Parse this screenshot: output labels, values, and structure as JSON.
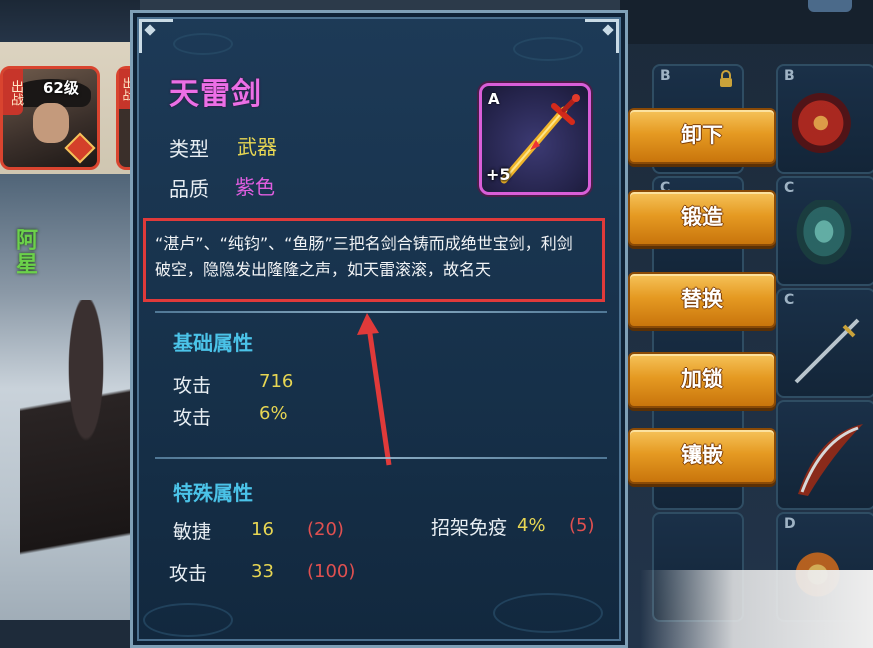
{
  "hero": {
    "status_tag": "出战",
    "level": "62级",
    "status_tag_2": "出战",
    "name": "阿星"
  },
  "item": {
    "name": "天雷剑",
    "type_label": "类型",
    "type_value": "武器",
    "quality_label": "品质",
    "quality_value": "紫色",
    "grade": "A",
    "enhance": "+5",
    "description": "“湛卢”、“纯钧”、“鱼肠”三把名剑合铸而成绝世宝剑，利剑破空，隐隐发出隆隆之声，如天雷滚滚，故名天"
  },
  "base_attrs": {
    "title": "基础属性",
    "rows": [
      {
        "label": "攻击",
        "value": "716"
      },
      {
        "label": "攻击",
        "value": "6%"
      }
    ]
  },
  "special_attrs": {
    "title": "特殊属性",
    "rows": [
      {
        "label": "敏捷",
        "value": "16",
        "max": "(20)"
      },
      {
        "label": "攻击",
        "value": "33",
        "max": "(100)"
      }
    ],
    "parry": {
      "label": "招架免疫",
      "value": "4%",
      "max": "(5)"
    }
  },
  "actions": {
    "unequip": "卸下",
    "forge": "锻造",
    "replace": "替换",
    "lock": "加锁",
    "inlay": "镶嵌"
  },
  "inventory": {
    "grades": [
      "B",
      "B",
      "C",
      "C",
      "C",
      "C",
      "D"
    ]
  },
  "colors": {
    "item_name": "#ec6fe6",
    "type_value": "#e7d653",
    "quality_value": "#e05ee0",
    "section_title": "#4bc3e8",
    "highlight_box": "#e03a3a",
    "button": "#e59a22"
  }
}
